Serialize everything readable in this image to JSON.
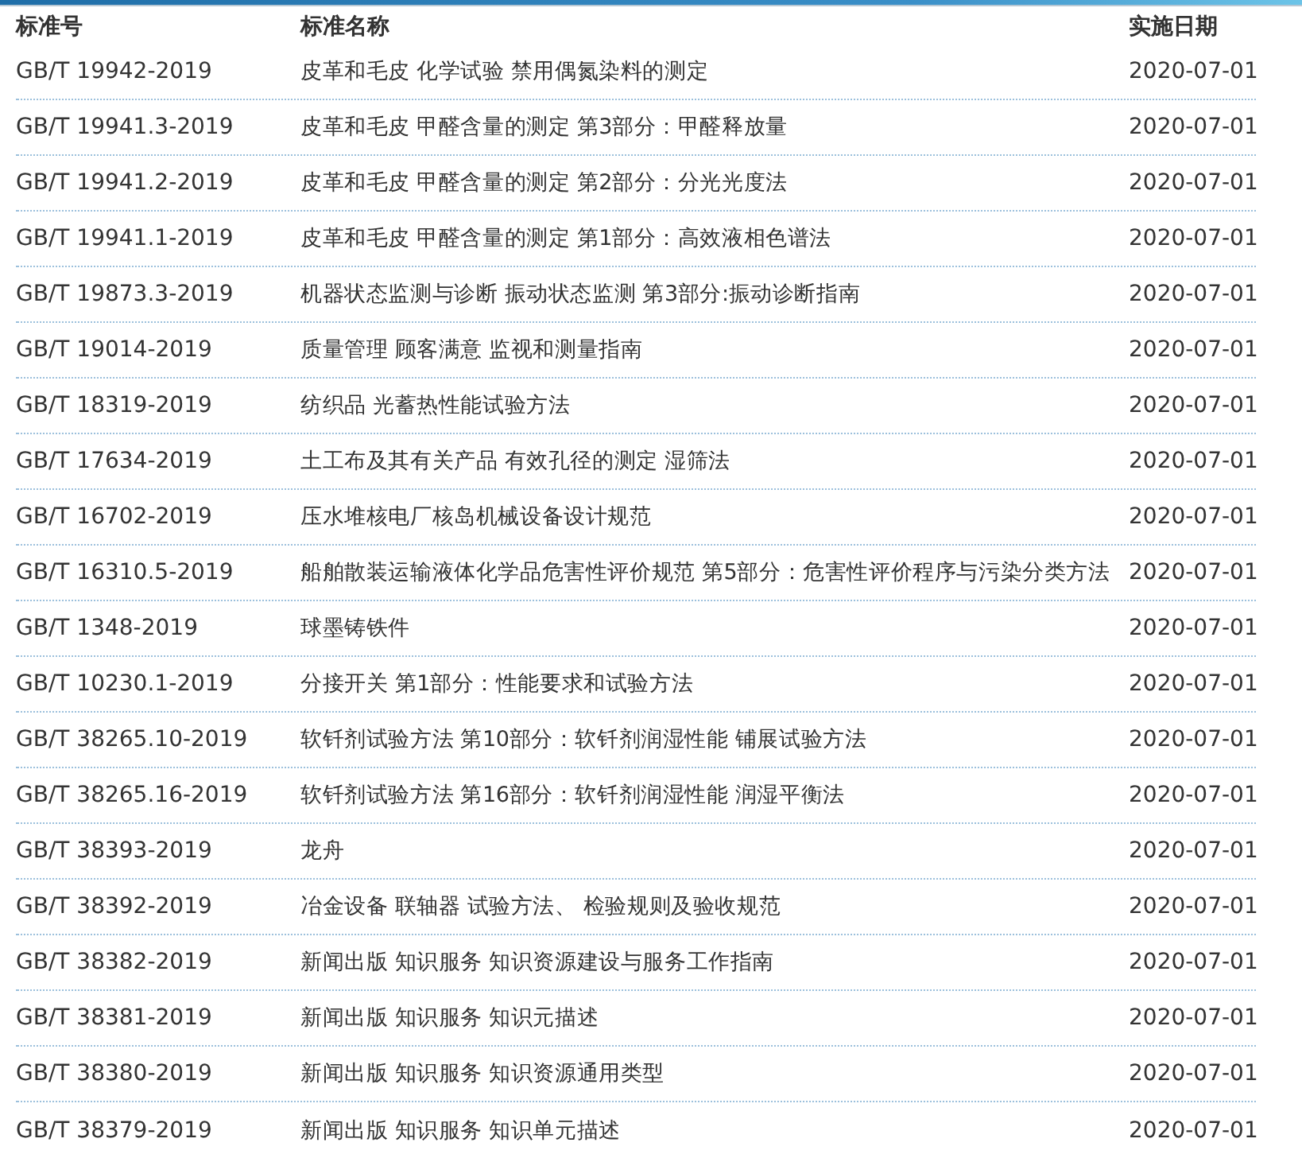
{
  "table": {
    "columns": [
      "标准号",
      "标准名称",
      "实施日期"
    ],
    "rows": [
      {
        "code": "GB/T 19942-2019",
        "name": "皮革和毛皮 化学试验 禁用偶氮染料的测定",
        "date": "2020-07-01"
      },
      {
        "code": "GB/T 19941.3-2019",
        "name": "皮革和毛皮 甲醛含量的测定 第3部分：甲醛释放量",
        "date": "2020-07-01"
      },
      {
        "code": "GB/T 19941.2-2019",
        "name": "皮革和毛皮 甲醛含量的测定 第2部分：分光光度法",
        "date": "2020-07-01"
      },
      {
        "code": "GB/T 19941.1-2019",
        "name": "皮革和毛皮 甲醛含量的测定 第1部分：高效液相色谱法",
        "date": "2020-07-01"
      },
      {
        "code": "GB/T 19873.3-2019",
        "name": "机器状态监测与诊断 振动状态监测 第3部分:振动诊断指南",
        "date": "2020-07-01"
      },
      {
        "code": "GB/T 19014-2019",
        "name": "质量管理 顾客满意 监视和测量指南",
        "date": "2020-07-01"
      },
      {
        "code": "GB/T 18319-2019",
        "name": "纺织品 光蓄热性能试验方法",
        "date": "2020-07-01"
      },
      {
        "code": "GB/T 17634-2019",
        "name": "土工布及其有关产品 有效孔径的测定 湿筛法",
        "date": "2020-07-01"
      },
      {
        "code": "GB/T 16702-2019",
        "name": "压水堆核电厂核岛机械设备设计规范",
        "date": "2020-07-01"
      },
      {
        "code": "GB/T 16310.5-2019",
        "name": "船舶散装运输液体化学品危害性评价规范 第5部分：危害性评价程序与污染分类方法",
        "date": "2020-07-01"
      },
      {
        "code": "GB/T 1348-2019",
        "name": "球墨铸铁件",
        "date": "2020-07-01"
      },
      {
        "code": "GB/T 10230.1-2019",
        "name": "分接开关 第1部分：性能要求和试验方法",
        "date": "2020-07-01"
      },
      {
        "code": "GB/T 38265.10-2019",
        "name": "软钎剂试验方法 第10部分：软钎剂润湿性能 铺展试验方法",
        "date": "2020-07-01"
      },
      {
        "code": "GB/T 38265.16-2019",
        "name": "软钎剂试验方法 第16部分：软钎剂润湿性能 润湿平衡法",
        "date": "2020-07-01"
      },
      {
        "code": "GB/T 38393-2019",
        "name": "龙舟",
        "date": "2020-07-01"
      },
      {
        "code": "GB/T 38392-2019",
        "name": "冶金设备 联轴器 试验方法、 检验规则及验收规范",
        "date": "2020-07-01"
      },
      {
        "code": "GB/T 38382-2019",
        "name": "新闻出版 知识服务 知识资源建设与服务工作指南",
        "date": "2020-07-01"
      },
      {
        "code": "GB/T 38381-2019",
        "name": "新闻出版 知识服务 知识元描述",
        "date": "2020-07-01"
      },
      {
        "code": "GB/T 38380-2019",
        "name": "新闻出版 知识服务 知识资源通用类型",
        "date": "2020-07-01"
      },
      {
        "code": "GB/T 38379-2019",
        "name": "新闻出版 知识服务 知识单元描述",
        "date": "2020-07-01"
      }
    ]
  }
}
